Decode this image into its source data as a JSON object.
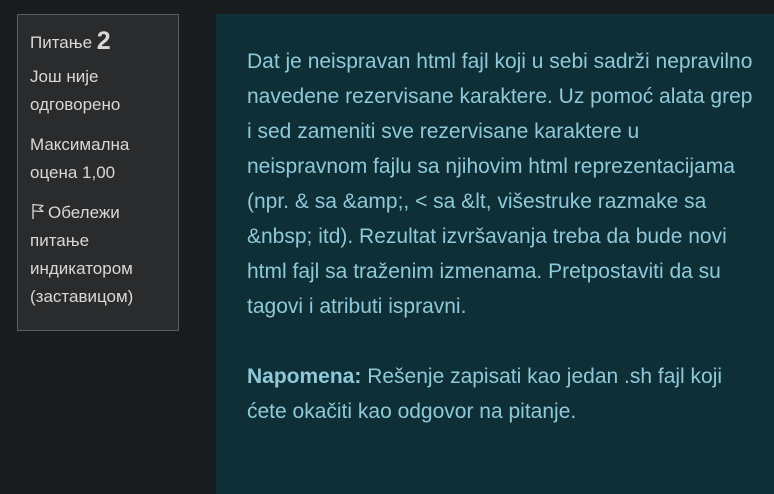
{
  "question_info": {
    "label": "Питање",
    "number": "2",
    "state": "Још није одговорено",
    "grade": "Максимална оцена 1,00",
    "flag_label": "Обележи питање индикатором (заставицом)",
    "flag_icon": "flag-icon"
  },
  "question": {
    "text": "Dat je neispravan html fajl koji u sebi sadrži nepravilno navedene rezervisane karaktere. Uz pomoć alata grep i sed zameniti sve rezervisane karaktere u neispravnom fajlu sa njihovim html reprezentacijama (npr. & sa &amp;, < sa &lt, višestruke razmake sa &nbsp; itd). Rezultat izvršavanja treba da bude novi html fajl sa traženim izmenama. Pretpostaviti da su tagovi i atributi ispravni.",
    "note_label": "Napomena:",
    "note_text": " Rešenje zapisati kao jedan .sh fajl koji ćete okačiti kao odgovor na pitanje."
  },
  "colors": {
    "page_bg": "#1a1b1e",
    "info_bg": "#2a2b2d",
    "content_bg": "#0f2f37",
    "content_text": "#8fc9d9"
  }
}
